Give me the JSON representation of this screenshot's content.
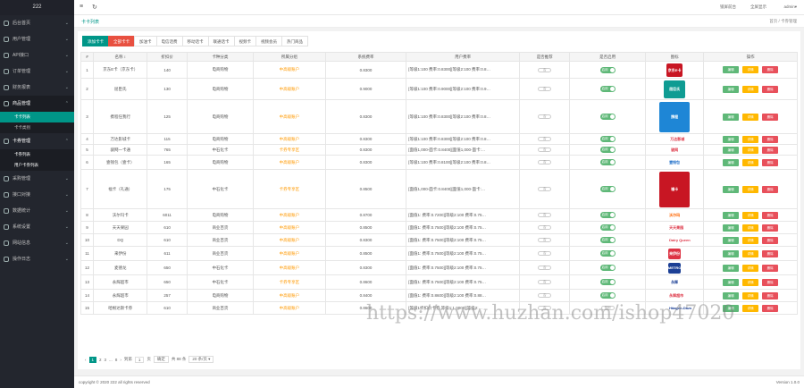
{
  "app": {
    "logo": "222"
  },
  "sidebar": {
    "items": [
      {
        "label": "后台首页",
        "arrow": "⌄"
      },
      {
        "label": "用户管理",
        "arrow": "⌄"
      },
      {
        "label": "API接口",
        "arrow": "⌄"
      },
      {
        "label": "订单管理",
        "arrow": "⌄"
      },
      {
        "label": "财务报表",
        "arrow": "⌄"
      },
      {
        "label": "商品管理",
        "arrow": "⌃"
      },
      {
        "label": "卡券管理",
        "arrow": "⌃"
      },
      {
        "label": "采购管理",
        "arrow": "⌄"
      },
      {
        "label": "接口对接",
        "arrow": "⌄"
      },
      {
        "label": "数据统计",
        "arrow": "⌄"
      },
      {
        "label": "系统设置",
        "arrow": "⌄"
      },
      {
        "label": "网站信息",
        "arrow": "⌄"
      },
      {
        "label": "操作日志",
        "arrow": "⌄"
      }
    ],
    "sub_goods": [
      "卡卡列表",
      "卡卡类别"
    ],
    "sub_cards": [
      "卡券列表",
      "用户卡券列表"
    ]
  },
  "topbar": {
    "menu": "≡",
    "refresh": "↻",
    "lock": "锁屏前台",
    "fullscreen": "全屏显示",
    "user": "admin▾"
  },
  "tabbar": {
    "title": "卡卡列表",
    "crumb": "首页 / 卡券管理"
  },
  "filters": [
    "添加卡卡",
    "全部卡卡",
    "加油卡",
    "电信话费",
    "移动话卡",
    "联通话卡",
    "视频卡",
    "视频会员",
    "热门商品"
  ],
  "table": {
    "headers": [
      "#",
      "名称 ↕",
      "折扣价",
      "卡种分类",
      "所属分组",
      "系统费率",
      "用户费率",
      "是否推荐",
      "是否启用",
      "图标",
      "操作"
    ],
    "rows": [
      {
        "id": "1",
        "name": "京东E卡（京东卡）",
        "price": "140",
        "cat": "电商购物",
        "group": "中高级账户",
        "sys": "0.8300",
        "user": "[等级1:100 费率:0.8300][等级2:100 费率:0.8…",
        "rec": "否",
        "on": "启用",
        "logo": "京东E卡",
        "lc": "#c81623",
        "lt": "#fff",
        "h": 19
      },
      {
        "id": "2",
        "name": "屈臣氏",
        "price": "130",
        "cat": "电商购物",
        "group": "中高级账户",
        "sys": "0.9000",
        "user": "[等级1:100 费率:0.9000][等级2:100 费率:0.9…",
        "rec": "否",
        "on": "启用",
        "logo": "屈臣氏",
        "lc": "#0f9c93",
        "lt": "#fff",
        "h": 24
      },
      {
        "id": "3",
        "name": "携程任我行",
        "price": "125",
        "cat": "电商购物",
        "group": "中高级账户",
        "sys": "0.8300",
        "user": "[等级1:100 费率:0.8300][等级2:100 费率:0.8…",
        "rec": "否",
        "on": "启用",
        "logo": "携程",
        "lc": "#1e86d6",
        "lt": "#fff",
        "h": 38
      },
      {
        "id": "4",
        "name": "万达影城卡",
        "price": "115",
        "cat": "电商购物",
        "group": "中高级账户",
        "sys": "0.8300",
        "user": "[等级1:100 费率:0.8300][等级2:100 费率:0.8…",
        "rec": "否",
        "on": "启用",
        "logo": "万达影城",
        "lc": "#fff",
        "lt": "#d34",
        "h": 12
      },
      {
        "id": "5",
        "name": "骏网一卡通",
        "price": "765",
        "cat": "中石化卡",
        "group": "卡券专享区",
        "sys": "0.8300",
        "user": "[面值1,000-面卡:0.8400][面值1,000-面卡:…",
        "rec": "否",
        "on": "启用",
        "logo": "骏网",
        "lc": "#fff",
        "lt": "#d34",
        "h": 12
      },
      {
        "id": "6",
        "name": "壹钱包（壹卡）",
        "price": "165",
        "cat": "电商购物",
        "group": "中高级账户",
        "sys": "0.8300",
        "user": "[等级1:100 费率:0.8100][等级2:100 费率:0.8…",
        "rec": "否",
        "on": "启用",
        "logo": "壹钱包",
        "lc": "#fff",
        "lt": "#1e6ec8",
        "h": 16
      },
      {
        "id": "7",
        "name": "福卡（礼通）",
        "price": "175",
        "cat": "中石化卡",
        "group": "卡券专享区",
        "sys": "0.8500",
        "user": "[面值1,000-面卡:0.8400][面值1,000-面卡:…",
        "rec": "否",
        "on": "启用",
        "logo": "福卡",
        "lc": "#c81623",
        "lt": "#fff",
        "h": 44
      },
      {
        "id": "8",
        "name": "沃尔玛卡",
        "price": "6011",
        "cat": "电商购物",
        "group": "中高级账户",
        "sys": "0.8700",
        "user": "[面值1: 费率:0.7200][等级2:100 费率:0.75…",
        "rec": "否",
        "on": "启用",
        "logo": "沃尔玛",
        "lc": "#fff",
        "lt": "#f60",
        "h": 14
      },
      {
        "id": "9",
        "name": "天天果园",
        "price": "610",
        "cat": "商业百货",
        "group": "中高级账户",
        "sys": "0.8500",
        "user": "[面值1: 费率:0.7500][等级2:100 费率:0.75…",
        "rec": "否",
        "on": "启用",
        "logo": "天天果园",
        "lc": "#fff",
        "lt": "#d34",
        "h": 14
      },
      {
        "id": "10",
        "name": "DQ",
        "price": "610",
        "cat": "商业百货",
        "group": "中高级账户",
        "sys": "0.8300",
        "user": "[面值1: 费率:0.7500][等级2:100 费率:0.75…",
        "rec": "否",
        "on": "启用",
        "logo": "Dairy Queen",
        "lc": "#fff",
        "lt": "#d34",
        "h": 14
      },
      {
        "id": "11",
        "name": "来伊份",
        "price": "611",
        "cat": "商业百货",
        "group": "中高级账户",
        "sys": "0.8500",
        "user": "[面值1: 费率:0.7500][等级2:100 费率:0.75…",
        "rec": "否",
        "on": "启用",
        "logo": "来伊份",
        "lc": "#d34",
        "lt": "#fff",
        "h": 16
      },
      {
        "id": "12",
        "name": "麦德龙",
        "price": "650",
        "cat": "中石化卡",
        "group": "中高级账户",
        "sys": "0.8300",
        "user": "[面值1: 费率:0.7500][等级2:100 费率:0.75…",
        "rec": "否",
        "on": "启用",
        "logo": "METRO",
        "lc": "#1b3f95",
        "lt": "#fff",
        "h": 16
      },
      {
        "id": "13",
        "name": "永辉超市",
        "price": "650",
        "cat": "中石化卡",
        "group": "卡券专享区",
        "sys": "0.8600",
        "user": "[面值1: 费率:0.7500][等级2:100 费率:0.75…",
        "rec": "否",
        "on": "启用",
        "logo": "永辉",
        "lc": "#fff",
        "lt": "#1b3f95",
        "h": 16
      },
      {
        "id": "14",
        "name": "永辉超市",
        "price": "257",
        "cat": "电商购物",
        "group": "中高级账户",
        "sys": "0.8400",
        "user": "[面值1: 费率:0.8600][等级2:100 费率:0.88…",
        "rec": "否",
        "on": "启用",
        "logo": "永辉超市",
        "lc": "#fff",
        "lt": "#d34",
        "h": 14
      },
      {
        "id": "15",
        "name": "哈根达斯卡券",
        "price": "610",
        "cat": "商业百货",
        "group": "中高级账户",
        "sys": "0.8600",
        "user": "[等级1折扣价卡券 等级1:1.0000][等级2:…",
        "rec": "否",
        "on": "禁用",
        "logo": "Häagen-Dazs",
        "lc": "#fff",
        "lt": "#1b3f95",
        "h": 14
      }
    ],
    "actions": [
      "编辑",
      "详情",
      "删除"
    ]
  },
  "pager": {
    "prev": "‹",
    "p1": "1",
    "p2": "2",
    "p3": "3",
    "dots": "...",
    "p8": "8",
    "next": "›",
    "goto": "到第",
    "page_val": "1",
    "page": "页",
    "go": "确定",
    "total": "共 88 条",
    "per": "20 条/页 ▾"
  },
  "footer": {
    "copyright": "copyright © 2020 222 all rights reserved",
    "version": "Version 1.0.0"
  },
  "watermark": "https://www.huzhan.com/ishop47020"
}
